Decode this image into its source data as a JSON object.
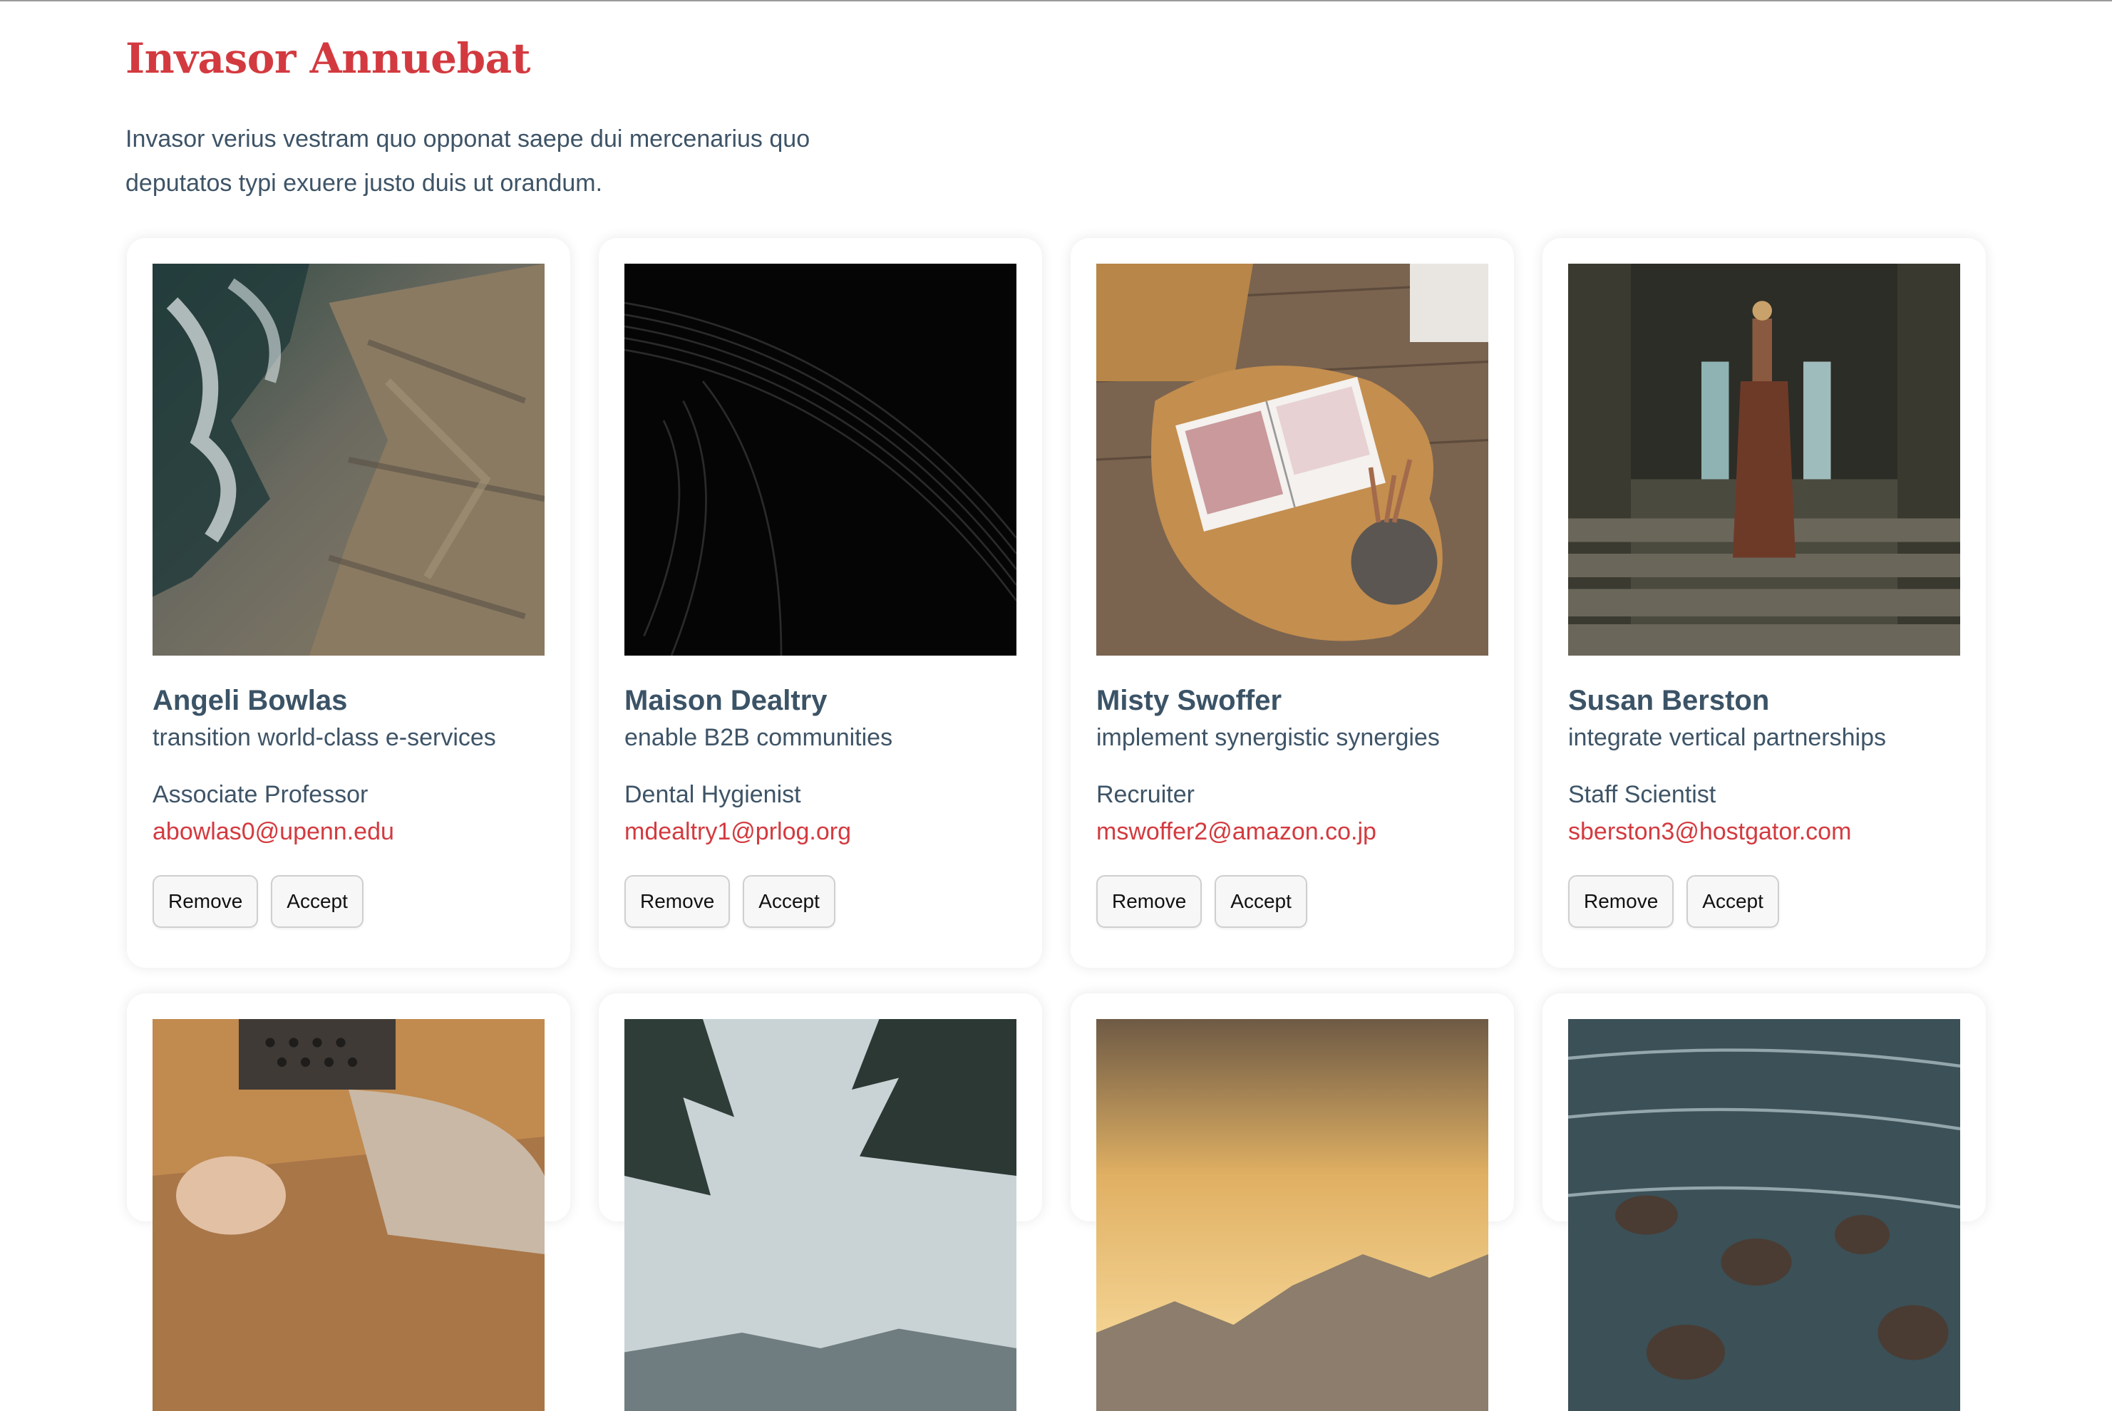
{
  "header": {
    "title": "Invasor Annuebat",
    "subtitle": "Invasor verius vestram quo opponat saepe dui mercenarius quo deputatos typi exuere justo duis ut orandum."
  },
  "cards": [
    {
      "name": "Angeli Bowlas",
      "tagline": "transition world-class e-services",
      "role": "Associate Professor",
      "email": "abowlas0@upenn.edu",
      "remove_label": "Remove",
      "accept_label": "Accept"
    },
    {
      "name": "Maison Dealtry",
      "tagline": "enable B2B communities",
      "role": "Dental Hygienist",
      "email": "mdealtry1@prlog.org",
      "remove_label": "Remove",
      "accept_label": "Accept"
    },
    {
      "name": "Misty Swoffer",
      "tagline": "implement synergistic synergies",
      "role": "Recruiter",
      "email": "mswoffer2@amazon.co.jp",
      "remove_label": "Remove",
      "accept_label": "Accept"
    },
    {
      "name": "Susan Berston",
      "tagline": "integrate vertical partnerships",
      "role": "Staff Scientist",
      "email": "sberston3@hostgator.com",
      "remove_label": "Remove",
      "accept_label": "Accept"
    }
  ],
  "colors": {
    "accent": "#d33a3f",
    "text": "#3e5467"
  }
}
